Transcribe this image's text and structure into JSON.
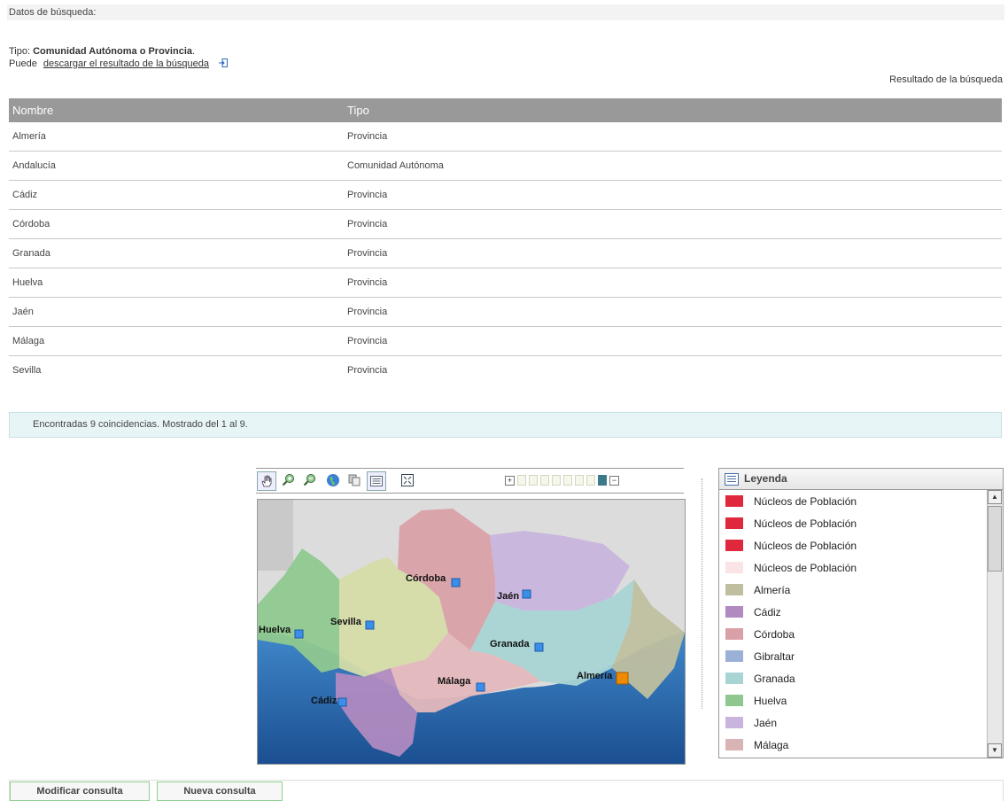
{
  "search": {
    "header": "Datos de búsqueda:",
    "tipo_prefix": "Tipo:",
    "tipo_value": "Comunidad Autónoma o Provincia",
    "tipo_suffix": ".",
    "download_prefix": "Puede",
    "download_link": "descargar el resultado de la búsqueda",
    "result_label": "Resultado de la búsqueda"
  },
  "table": {
    "headers": [
      "Nombre",
      "Tipo"
    ],
    "rows": [
      {
        "nombre": "Almería",
        "tipo": "Provincia"
      },
      {
        "nombre": "Andalucía",
        "tipo": "Comunidad Autónoma"
      },
      {
        "nombre": "Cádiz",
        "tipo": "Provincia"
      },
      {
        "nombre": "Córdoba",
        "tipo": "Provincia"
      },
      {
        "nombre": "Granada",
        "tipo": "Provincia"
      },
      {
        "nombre": "Huelva",
        "tipo": "Provincia"
      },
      {
        "nombre": "Jaén",
        "tipo": "Provincia"
      },
      {
        "nombre": "Málaga",
        "tipo": "Provincia"
      },
      {
        "nombre": "Sevilla",
        "tipo": "Provincia"
      }
    ]
  },
  "found": "Encontradas 9 coincidencias. Mostrado del  1 al 9.",
  "map": {
    "tools": [
      "pan-hand-icon",
      "zoom-in-icon",
      "zoom-out-icon",
      "globe-icon",
      "copy-icon",
      "list-icon",
      "fullscreen-icon"
    ],
    "zoom_levels": 8,
    "zoom_selected": 7,
    "labels": {
      "cordoba": "Córdoba",
      "jaen": "Jaén",
      "huelva": "Huelva",
      "sevilla": "Sevilla",
      "granada": "Granada",
      "almeria": "Almería",
      "malaga": "Málaga",
      "cadiz": "Cádiz"
    }
  },
  "legend": {
    "title": "Leyenda",
    "items": [
      {
        "label": "Núcleos de Población",
        "color": "#e0283c"
      },
      {
        "label": "Núcleos de Población",
        "color": "#e0283c"
      },
      {
        "label": "Núcleos de Población",
        "color": "#e0283c"
      },
      {
        "label": "Núcleos de Población",
        "color": "#fbe4e6"
      },
      {
        "label": "Almería",
        "color": "#bfbf9f"
      },
      {
        "label": "Cádiz",
        "color": "#b08ac0"
      },
      {
        "label": "Córdoba",
        "color": "#d9a0a8"
      },
      {
        "label": "Gibraltar",
        "color": "#9ab0d6"
      },
      {
        "label": "Granada",
        "color": "#a8d4d4"
      },
      {
        "label": "Huelva",
        "color": "#8fc88f"
      },
      {
        "label": "Jaén",
        "color": "#c8b4dc"
      },
      {
        "label": "Málaga",
        "color": "#d8b4b4"
      }
    ]
  },
  "buttons": {
    "modify": "Modificar consulta",
    "new": "Nueva consulta"
  }
}
